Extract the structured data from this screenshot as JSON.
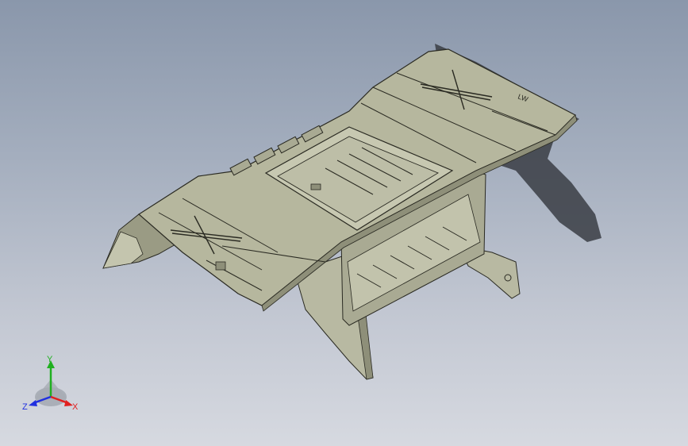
{
  "viewport": {
    "background_top": "#8a97ab",
    "background_bottom": "#d6d9e0"
  },
  "model": {
    "body_color": "#b6b79e",
    "body_shade": "#8e8f79",
    "edge_color": "#2a2a22",
    "shadow_color": "#3a3d44",
    "marking_text": "LW"
  },
  "triad": {
    "x_label": "X",
    "y_label": "Y",
    "z_label": "Z",
    "x_color": "#e02020",
    "y_color": "#20b020",
    "z_color": "#2030e0"
  }
}
